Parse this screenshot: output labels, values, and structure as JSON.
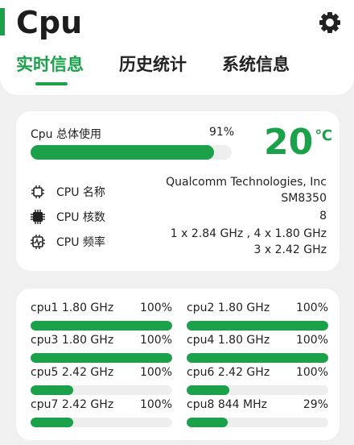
{
  "app": {
    "title": "Cpu",
    "settings_icon": "gear-icon"
  },
  "tabs": [
    {
      "label": "实时信息",
      "active": true
    },
    {
      "label": "历史统计",
      "active": false
    },
    {
      "label": "系统信息",
      "active": false
    }
  ],
  "overview": {
    "usage_label": "Cpu 总体使用",
    "usage_text": "91%",
    "usage_fraction": 0.91,
    "temperature": "20",
    "temperature_unit": "℃"
  },
  "info": [
    {
      "icon": "chip-icon",
      "label": "CPU 名称",
      "value_lines": [
        "Qualcomm Technologies, Inc",
        "SM8350"
      ]
    },
    {
      "icon": "cores-icon",
      "label": "CPU 核数",
      "value_lines": [
        "8"
      ]
    },
    {
      "icon": "frequency-icon",
      "label": "CPU 频率",
      "value_lines": [
        "1 x 2.84 GHz , 4 x 1.80 GHz",
        "3 x 2.42 GHz"
      ]
    }
  ],
  "cores": [
    {
      "label": "cpu1  1.80 GHz",
      "pct": "100%",
      "fill": 1.0
    },
    {
      "label": "cpu2  1.80 GHz",
      "pct": "100%",
      "fill": 1.0
    },
    {
      "label": "cpu3  1.80 GHz",
      "pct": "100%",
      "fill": 1.0
    },
    {
      "label": "cpu4  1.80 GHz",
      "pct": "100%",
      "fill": 1.0
    },
    {
      "label": "cpu5  2.42 GHz",
      "pct": "100%",
      "fill": 0.3
    },
    {
      "label": "cpu6  2.42 GHz",
      "pct": "100%",
      "fill": 0.3
    },
    {
      "label": "cpu7  2.42 GHz",
      "pct": "100%",
      "fill": 0.3
    },
    {
      "label": "cpu8  844 MHz",
      "pct": "29%",
      "fill": 0.29
    }
  ],
  "colors": {
    "accent": "#1aa14a",
    "track": "#eeeeee",
    "background": "#f0f0f0"
  }
}
